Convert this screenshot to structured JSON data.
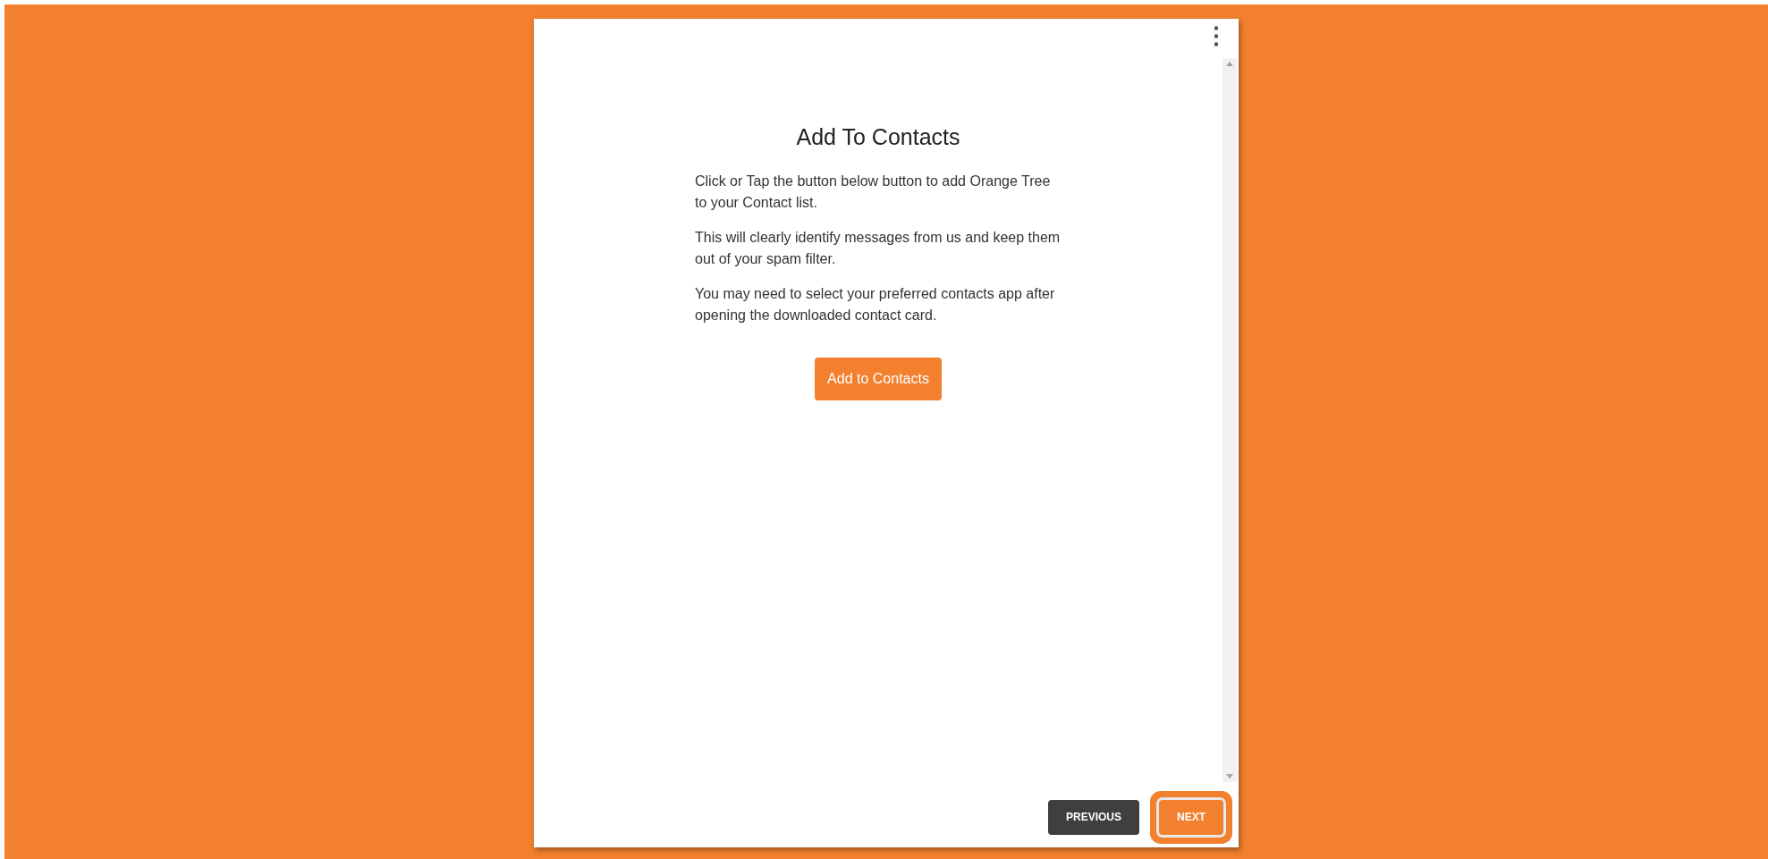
{
  "dialog": {
    "menu_icon": "⋮",
    "title": "Add To Contacts",
    "paragraphs": [
      "Click or Tap the button below button to add Orange Tree to your Contact list.",
      "This will clearly identify messages from us and keep them out of your spam filter.",
      "You may need to select your preferred contacts app after opening the downloaded contact card."
    ],
    "action_button": "Add to Contacts"
  },
  "footer_buttons": [
    {
      "label": "PREVIOUS",
      "kind": "secondary",
      "focused": false
    },
    {
      "label": "NEXT",
      "kind": "primary",
      "focused": true
    }
  ]
}
